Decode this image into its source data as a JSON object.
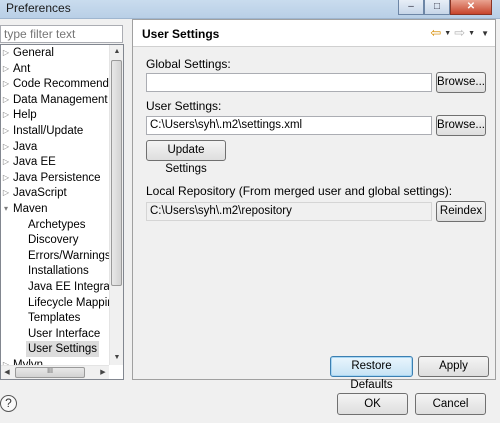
{
  "window": {
    "title": "Preferences",
    "buttons": [
      "–",
      "□",
      "✕"
    ]
  },
  "filter": {
    "placeholder": "type filter text"
  },
  "tree": {
    "items": [
      {
        "label": "General",
        "expanded": false,
        "child": false
      },
      {
        "label": "Ant",
        "expanded": false,
        "child": false
      },
      {
        "label": "Code Recommenders",
        "expanded": false,
        "child": false
      },
      {
        "label": "Data Management",
        "expanded": false,
        "child": false
      },
      {
        "label": "Help",
        "expanded": false,
        "child": false
      },
      {
        "label": "Install/Update",
        "expanded": false,
        "child": false
      },
      {
        "label": "Java",
        "expanded": false,
        "child": false
      },
      {
        "label": "Java EE",
        "expanded": false,
        "child": false
      },
      {
        "label": "Java Persistence",
        "expanded": false,
        "child": false
      },
      {
        "label": "JavaScript",
        "expanded": false,
        "child": false
      },
      {
        "label": "Maven",
        "expanded": true,
        "child": false
      },
      {
        "label": "Archetypes",
        "child": true
      },
      {
        "label": "Discovery",
        "child": true
      },
      {
        "label": "Errors/Warnings",
        "child": true
      },
      {
        "label": "Installations",
        "child": true
      },
      {
        "label": "Java EE Integration",
        "child": true
      },
      {
        "label": "Lifecycle Mappings",
        "child": true
      },
      {
        "label": "Templates",
        "child": true
      },
      {
        "label": "User Interface",
        "child": true
      },
      {
        "label": "User Settings",
        "child": true,
        "selected": true
      },
      {
        "label": "Mylyn",
        "expanded": false,
        "child": false
      }
    ],
    "hscroll_thumb": "III"
  },
  "page": {
    "title": "User Settings",
    "global_settings_label": "Global Settings:",
    "global_settings_value": "",
    "user_settings_label": "User Settings:",
    "user_settings_value": "C:\\Users\\syh\\.m2\\settings.xml",
    "browse_label": "Browse...",
    "update_settings_label": "Update Settings",
    "local_repo_label": "Local Repository (From merged user and global settings):",
    "local_repo_value": "C:\\Users\\syh\\.m2\\repository",
    "reindex_label": "Reindex",
    "restore_defaults_label": "Restore Defaults",
    "apply_label": "Apply"
  },
  "footer": {
    "help_glyph": "?",
    "ok_label": "OK",
    "cancel_label": "Cancel"
  },
  "colors": {
    "nav_back": "#d68b00",
    "selection": "#dcdcdc"
  }
}
